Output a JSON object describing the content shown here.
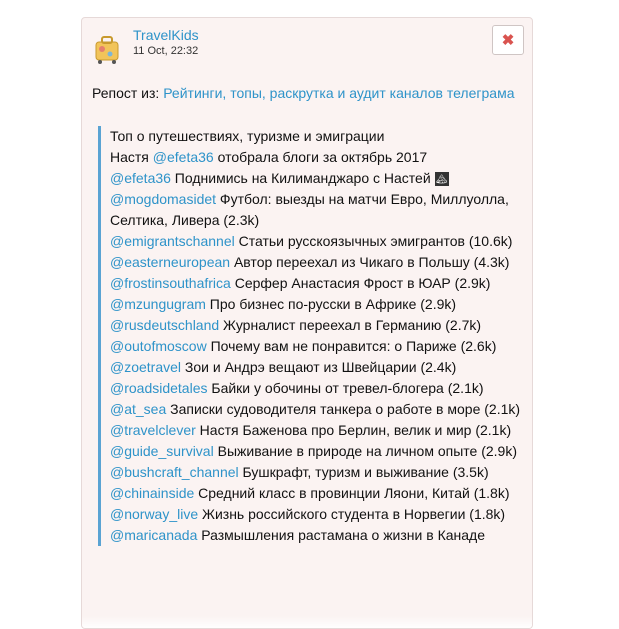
{
  "post": {
    "channel_name": "TravelKids",
    "time": "11 Oct, 22:32",
    "repost_prefix": "Репост из:",
    "repost_source": "Рейтинги, топы, раскрутка и аудит каналов телеграма",
    "lines": [
      {
        "text": "Топ о путешествиях, туризме и эмиграции"
      },
      {
        "prefix": "Настя ",
        "handle": "@efeta36",
        "text": " отобрала блоги за октябрь 2017"
      },
      {
        "handle": "@efeta36",
        "text": " Поднимись на Килиманджаро с Настей",
        "emoji": "🏔"
      },
      {
        "handle": "@mogdomasidet",
        "text": " Футбол: выезды на матчи Евро, Миллуолла, Селтика, Ливера (2.3k)"
      },
      {
        "handle": "@emigrantschannel",
        "text": " Статьи русскоязычных эмигрантов (10.6k)"
      },
      {
        "handle": "@easterneuropean",
        "text": " Автор переехал из Чикаго в Польшу (4.3k)"
      },
      {
        "handle": "@frostinsouthafrica",
        "text": " Серфер Анастасия Фрост в ЮАР (2.9k)"
      },
      {
        "handle": "@mzungugram",
        "text": " Про бизнес по-русски в Африке (2.9k)"
      },
      {
        "handle": "@rusdeutschland",
        "text": " Журналист переехал в Германию (2.7k)"
      },
      {
        "handle": "@outofmoscow",
        "text": " Почему вам не понравится: о Париже (2.6k)"
      },
      {
        "handle": "@zoetravel",
        "text": " Зои и Андрэ вещают из Швейцарии (2.4k)"
      },
      {
        "handle": "@roadsidetales",
        "text": " Байки у обочины от тревел-блогера (2.1k)"
      },
      {
        "handle": "@at_sea",
        "text": " Записки судоводителя танкера о работе в море (2.1k)"
      },
      {
        "handle": "@travelclever",
        "text": " Настя Баженова про Берлин, велик и мир (2.1k)"
      },
      {
        "handle": "@guide_survival",
        "text": " Выживание в природе на личном опыте (2.9k)"
      },
      {
        "handle": "@bushcraft_channel",
        "text": " Бушкрафт, туризм и выживание (3.5k)"
      },
      {
        "handle": "@chinainside",
        "text": " Средний класс в провинции Ляони, Китай (1.8k)"
      },
      {
        "handle": "@norway_live",
        "text": " Жизнь российского студента в Норвегии (1.8k)"
      },
      {
        "handle": "@maricanada",
        "text": " Размышления растамана о жизни в Канаде"
      }
    ]
  },
  "icons": {
    "avatar": "suitcase-icon",
    "close": "close-icon"
  },
  "colors": {
    "link": "#2e93c9",
    "close": "#d9534f",
    "quote_bar": "#5aa3d3"
  }
}
